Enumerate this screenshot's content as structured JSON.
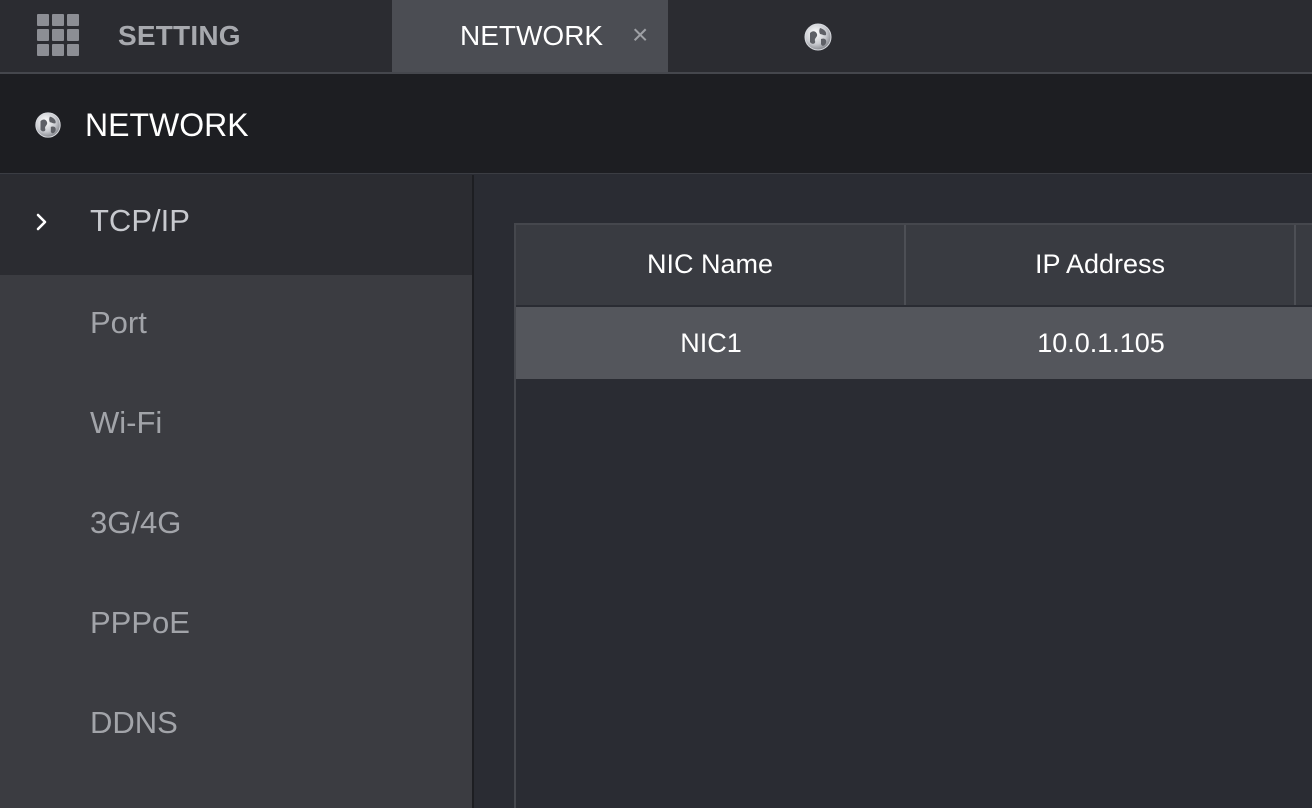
{
  "topbar": {
    "setting_label": "SETTING",
    "tab": {
      "label": "NETWORK",
      "close_symbol": "×"
    }
  },
  "header": {
    "title": "NETWORK"
  },
  "sidebar": {
    "items": [
      {
        "label": "TCP/IP",
        "active": true
      },
      {
        "label": "Port",
        "active": false
      },
      {
        "label": "Wi-Fi",
        "active": false
      },
      {
        "label": "3G/4G",
        "active": false
      },
      {
        "label": "PPPoE",
        "active": false
      },
      {
        "label": "DDNS",
        "active": false
      }
    ]
  },
  "table": {
    "columns": [
      "NIC Name",
      "IP Address"
    ],
    "rows": [
      [
        "NIC1",
        "10.0.1.105"
      ]
    ]
  },
  "icons": {
    "apps": "grid-icon",
    "network": "globe-icon",
    "chevron": "chevron-right-icon",
    "close": "close-icon"
  },
  "colors": {
    "topbar_bg": "#2b2c31",
    "active_tab_bg": "#4b4d53",
    "header_bg": "#1d1e22",
    "sidebar_bg": "#3b3c41",
    "sidebar_active_bg": "#2b2c31",
    "main_bg": "#2a2c33",
    "table_header_bg": "#393b41",
    "selected_row_bg": "#54565c",
    "text_primary": "#ffffff",
    "text_muted": "#a2a4a9"
  }
}
